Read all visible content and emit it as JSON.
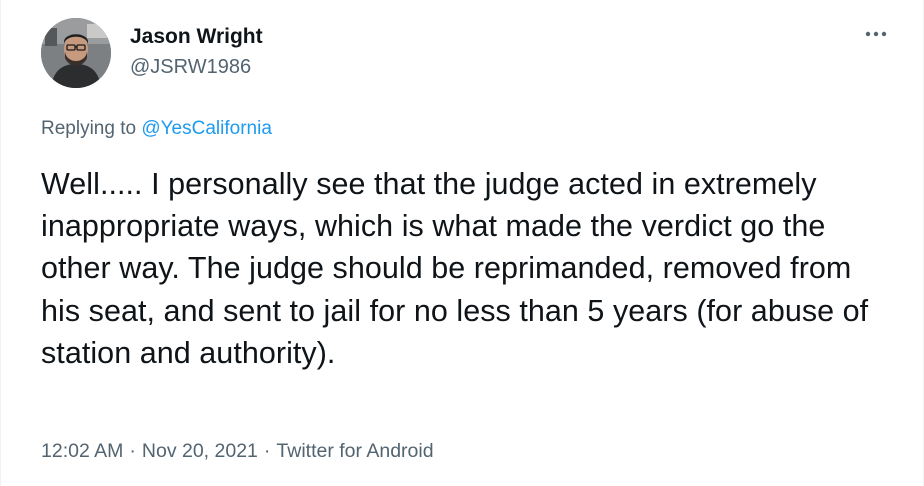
{
  "tweet": {
    "author": {
      "display_name": "Jason Wright",
      "handle": "@JSRW1986",
      "avatar_icon": "user-avatar-photo"
    },
    "more_icon": "more-horizontal-icon",
    "reply": {
      "prefix": "Replying to",
      "mention": "@YesCalifornia"
    },
    "text": "Well..... I personally see that the judge acted in extremely inappropriate ways, which is what made the verdict go the other way. The judge should be reprimanded, removed from his seat, and sent to jail for no less than 5 years (for abuse of station and authority).",
    "meta": {
      "time": "12:02 AM",
      "date": "Nov 20, 2021",
      "source": "Twitter for Android",
      "separator": "·"
    }
  },
  "colors": {
    "text_primary": "#0f1419",
    "text_secondary": "#536471",
    "accent": "#1d9bf0",
    "background": "#ffffff"
  }
}
